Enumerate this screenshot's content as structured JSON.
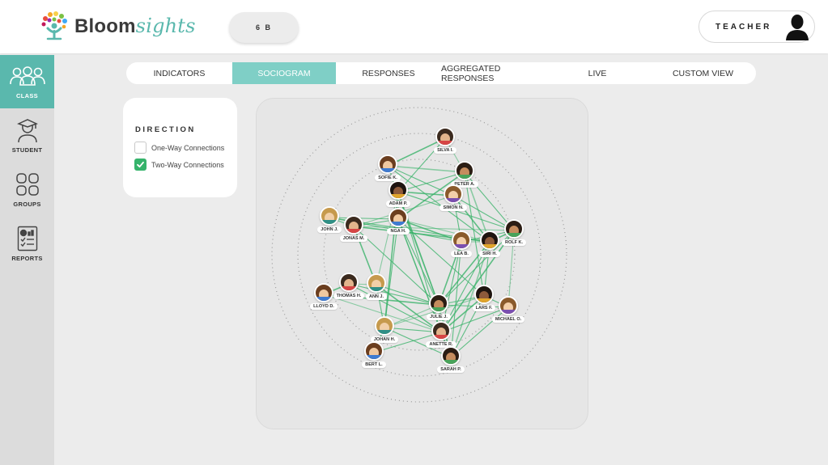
{
  "app": {
    "brand_prefix": "Bloom",
    "brand_suffix": "sights",
    "class_name": "6 B",
    "user_role": "TEACHER"
  },
  "sidebar": {
    "items": [
      {
        "label": "CLASS",
        "icon": "class-icon",
        "active": true
      },
      {
        "label": "STUDENT",
        "icon": "student-icon",
        "active": false
      },
      {
        "label": "GROUPS",
        "icon": "groups-icon",
        "active": false
      },
      {
        "label": "REPORTS",
        "icon": "reports-icon",
        "active": false
      }
    ]
  },
  "tabs": [
    {
      "label": "INDICATORS",
      "active": false
    },
    {
      "label": "SOCIOGRAM",
      "active": true
    },
    {
      "label": "RESPONSES",
      "active": false
    },
    {
      "label": "AGGREGATED RESPONSES",
      "active": false
    },
    {
      "label": "LIVE",
      "active": false
    },
    {
      "label": "CUSTOM VIEW",
      "active": false
    }
  ],
  "direction": {
    "title": "DIRECTION",
    "options": [
      {
        "label": "One-Way Connections",
        "checked": false
      },
      {
        "label": "Two-Way Connections",
        "checked": true
      }
    ]
  },
  "colors": {
    "accent": "#5ab8ad",
    "tab_active": "#7fcfc6",
    "edge": "#3bb36a",
    "checkbox": "#35b36b"
  },
  "students": [
    {
      "id": "silva",
      "name": "SILVA I."
    },
    {
      "id": "sofie",
      "name": "SOFIE K."
    },
    {
      "id": "peter",
      "name": "PETER A."
    },
    {
      "id": "adam",
      "name": "ADAM P."
    },
    {
      "id": "simon",
      "name": "SIMON N."
    },
    {
      "id": "john",
      "name": "JOHN J."
    },
    {
      "id": "jonas",
      "name": "JONAS M."
    },
    {
      "id": "nga",
      "name": "NGA H."
    },
    {
      "id": "rolf",
      "name": "ROLF K."
    },
    {
      "id": "siri",
      "name": "SIRI H."
    },
    {
      "id": "lea",
      "name": "LEA B."
    },
    {
      "id": "ann",
      "name": "ANN J."
    },
    {
      "id": "thomas",
      "name": "THOMAS H."
    },
    {
      "id": "lloyd",
      "name": "LLOYD D."
    },
    {
      "id": "julie",
      "name": "JULIE J."
    },
    {
      "id": "lars",
      "name": "LARS F."
    },
    {
      "id": "michael",
      "name": "MICHAEL O."
    },
    {
      "id": "johan",
      "name": "JOHAN H."
    },
    {
      "id": "anette",
      "name": "ANETTE R."
    },
    {
      "id": "bert",
      "name": "BERT L."
    },
    {
      "id": "sarah",
      "name": "SARAH P."
    }
  ],
  "connections": [
    [
      "sofie",
      "peter"
    ],
    [
      "sofie",
      "simon"
    ],
    [
      "sofie",
      "siri"
    ],
    [
      "sofie",
      "julie"
    ],
    [
      "sofie",
      "adam"
    ],
    [
      "adam",
      "peter"
    ],
    [
      "adam",
      "simon"
    ],
    [
      "adam",
      "rolf"
    ],
    [
      "adam",
      "julie"
    ],
    [
      "adam",
      "johan"
    ],
    [
      "adam",
      "anette"
    ],
    [
      "adam",
      "nga"
    ],
    [
      "peter",
      "siri"
    ],
    [
      "peter",
      "rolf"
    ],
    [
      "peter",
      "lars"
    ],
    [
      "peter",
      "nga"
    ],
    [
      "peter",
      "silva"
    ],
    [
      "silva",
      "adam"
    ],
    [
      "silva",
      "sofie"
    ],
    [
      "simon",
      "rolf"
    ],
    [
      "simon",
      "jonas"
    ],
    [
      "simon",
      "siri"
    ],
    [
      "simon",
      "lea"
    ],
    [
      "john",
      "nga"
    ],
    [
      "john",
      "jonas"
    ],
    [
      "john",
      "siri"
    ],
    [
      "john",
      "lea"
    ],
    [
      "jonas",
      "siri"
    ],
    [
      "jonas",
      "rolf"
    ],
    [
      "jonas",
      "julie"
    ],
    [
      "jonas",
      "ann"
    ],
    [
      "jonas",
      "nga"
    ],
    [
      "nga",
      "siri"
    ],
    [
      "nga",
      "lea"
    ],
    [
      "nga",
      "lars"
    ],
    [
      "nga",
      "anette"
    ],
    [
      "nga",
      "sarah"
    ],
    [
      "nga",
      "johan"
    ],
    [
      "nga",
      "julie"
    ],
    [
      "rolf",
      "siri"
    ],
    [
      "rolf",
      "michael"
    ],
    [
      "rolf",
      "lea"
    ],
    [
      "rolf",
      "anette"
    ],
    [
      "rolf",
      "julie"
    ],
    [
      "siri",
      "lea"
    ],
    [
      "siri",
      "julie"
    ],
    [
      "siri",
      "lars"
    ],
    [
      "siri",
      "anette"
    ],
    [
      "siri",
      "sarah"
    ],
    [
      "lea",
      "anette"
    ],
    [
      "lea",
      "sarah"
    ],
    [
      "lea",
      "julie"
    ],
    [
      "ann",
      "thomas"
    ],
    [
      "ann",
      "julie"
    ],
    [
      "ann",
      "anette"
    ],
    [
      "ann",
      "johan"
    ],
    [
      "ann",
      "adam"
    ],
    [
      "thomas",
      "lloyd"
    ],
    [
      "thomas",
      "julie"
    ],
    [
      "thomas",
      "anette"
    ],
    [
      "julie",
      "lars"
    ],
    [
      "julie",
      "michael"
    ],
    [
      "julie",
      "anette"
    ],
    [
      "julie",
      "sarah"
    ],
    [
      "julie",
      "johan"
    ],
    [
      "lars",
      "michael"
    ],
    [
      "lars",
      "anette"
    ],
    [
      "lars",
      "sarah"
    ],
    [
      "lars",
      "johan"
    ],
    [
      "johan",
      "bert"
    ],
    [
      "johan",
      "anette"
    ],
    [
      "johan",
      "sarah"
    ],
    [
      "anette",
      "sarah"
    ],
    [
      "anette",
      "michael"
    ],
    [
      "bert",
      "anette"
    ],
    [
      "lloyd",
      "julie"
    ],
    [
      "lloyd",
      "anette"
    ],
    [
      "michael",
      "sarah"
    ]
  ]
}
